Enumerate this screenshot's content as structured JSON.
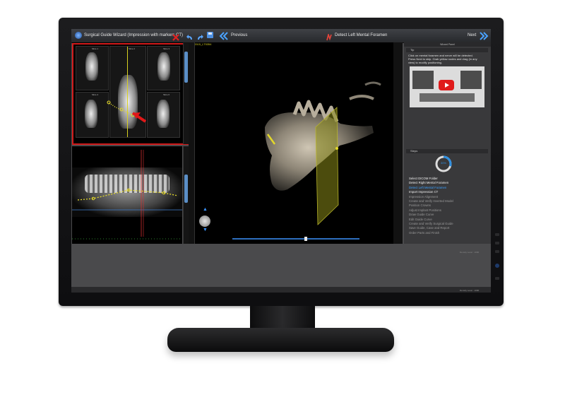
{
  "toolbar": {
    "title": "Surgical Guide Wizard (Impression with markers CT)",
    "previous_label": "Previous",
    "current_step": "Detect Left Mental Foramen",
    "next_label": "Next"
  },
  "viewer": {
    "slice_info": "1TS515_LT5354",
    "slice_labels": [
      "Slice 1",
      "Slice 2",
      "Slice 3",
      "Slice 4",
      "Slice 5",
      "Slice 6"
    ]
  },
  "wizard_panel": {
    "header": "Wizard Panel",
    "tip_header": "Tip",
    "tip_text": [
      "Click on mental foramen and nerve will be detected.",
      "Press Next to skip. Grab yellow nodes and drag (in any",
      "view) to modify positioning."
    ],
    "steps_header": "Steps",
    "progress_label": "30%",
    "steps": [
      {
        "label": "Select DICOM Folder",
        "state": "done"
      },
      {
        "label": "Detect Right Mental Foramen",
        "state": "done"
      },
      {
        "label": "Detect Left Mental Foramen",
        "state": "current"
      },
      {
        "label": "Import Impression CT",
        "state": "done"
      },
      {
        "label": "Impression Alignment",
        "state": "todo"
      },
      {
        "label": "Create and Verify Inverted Model",
        "state": "todo"
      },
      {
        "label": "Position Crowns",
        "state": "todo"
      },
      {
        "label": "Adjust Implant Positions",
        "state": "todo"
      },
      {
        "label": "Draw Guide Curve",
        "state": "todo"
      },
      {
        "label": "Edit Guide Curve",
        "state": "todo"
      },
      {
        "label": "Create and Verify Surgical Guide",
        "state": "todo"
      },
      {
        "label": "Save Guide, Case and Report",
        "state": "todo"
      },
      {
        "label": "Order Parts and Finish",
        "state": "todo"
      }
    ]
  },
  "status": {
    "density_top": "Density Level : 1090",
    "density_bottom": "Density Level : 1090"
  },
  "colors": {
    "accent": "#2f8fe0",
    "highlight_box": "#d11a1a",
    "marker": "#e3d82a",
    "current_step": "#3aa0ff"
  }
}
